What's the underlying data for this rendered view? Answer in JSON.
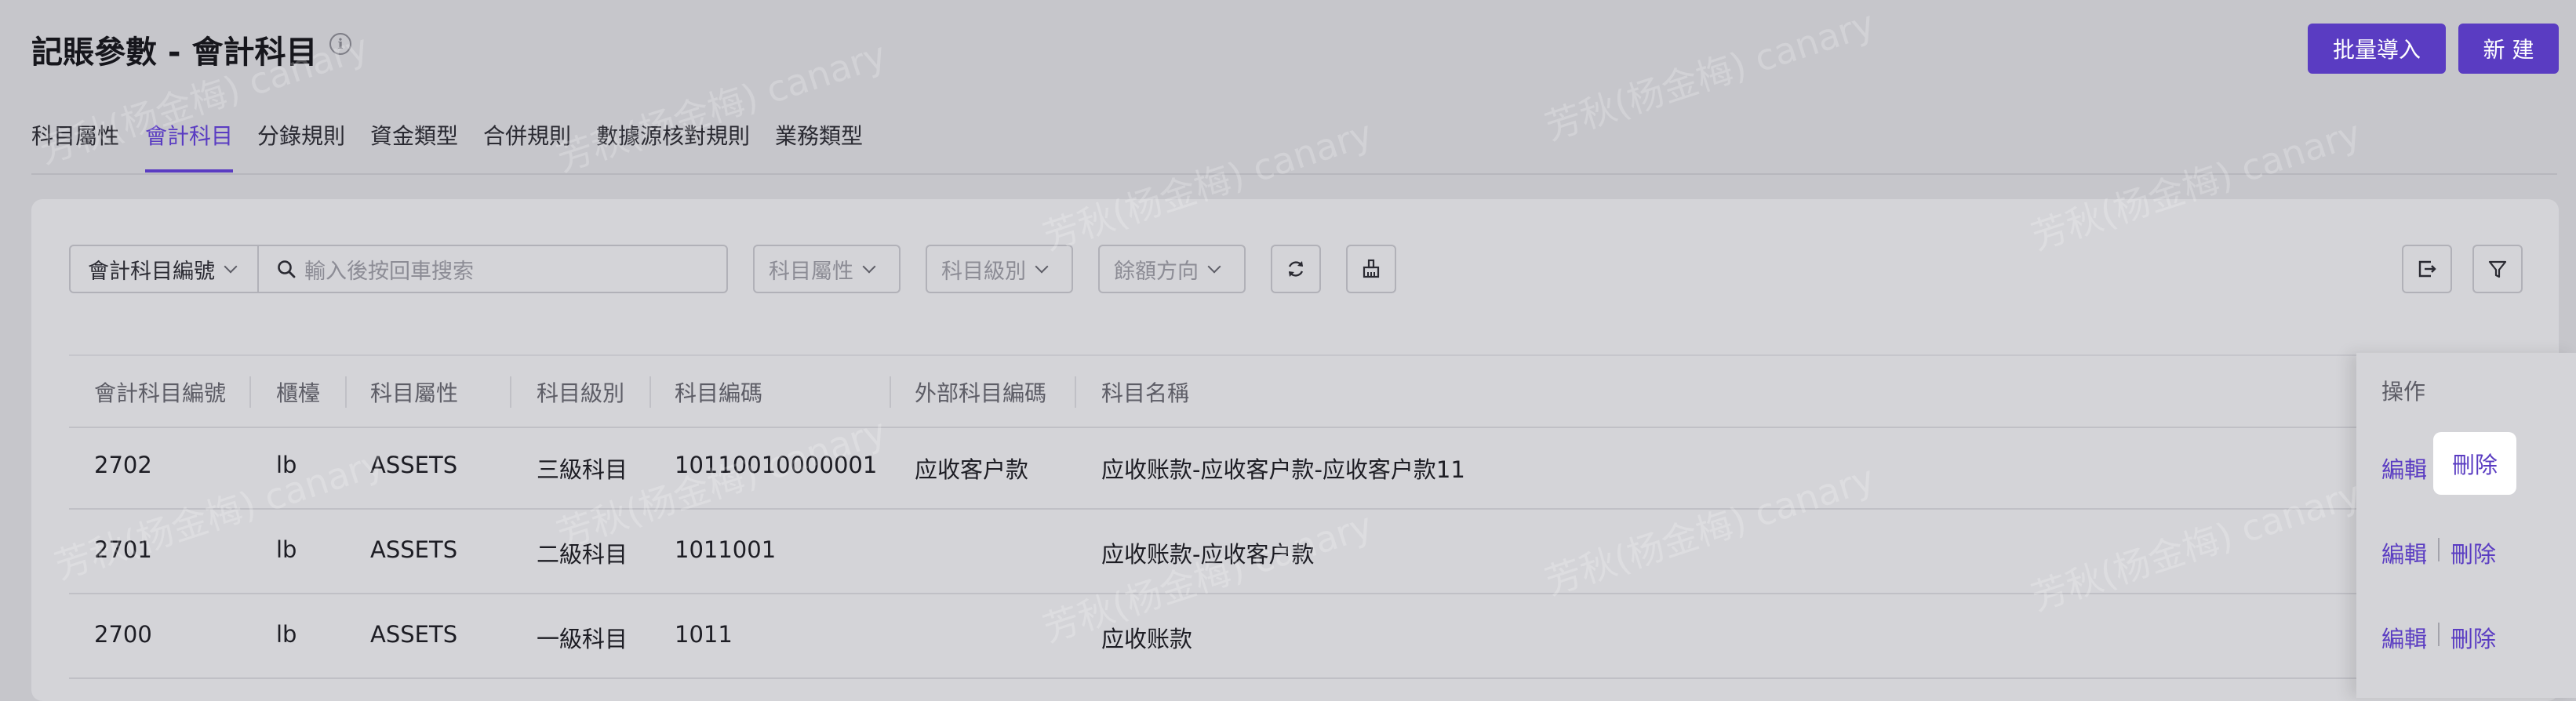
{
  "page": {
    "title": "記賬參數 - 會計科目",
    "info_icon": "info-circle-icon"
  },
  "header_buttons": {
    "batch_import": "批量導入",
    "create_new": "新 建"
  },
  "tabs": [
    {
      "label": "科目屬性",
      "active": false
    },
    {
      "label": "會計科目",
      "active": true
    },
    {
      "label": "分錄規則",
      "active": false
    },
    {
      "label": "資金類型",
      "active": false
    },
    {
      "label": "合併規則",
      "active": false
    },
    {
      "label": "數據源核對規則",
      "active": false
    },
    {
      "label": "業務類型",
      "active": false
    }
  ],
  "toolbar": {
    "search_field_select": "會計科目編號",
    "search_placeholder": "輸入後按回車搜索",
    "filter_attribute": "科目屬性",
    "filter_level": "科目級別",
    "filter_balance_direction": "餘額方向",
    "refresh_icon": "refresh-icon",
    "clean_icon": "broom-icon",
    "export_icon": "export-icon",
    "filter_icon": "filter-icon"
  },
  "table": {
    "columns": [
      "會計科目編號",
      "櫃檯",
      "科目屬性",
      "科目級別",
      "科目編碼",
      "外部科目編碼",
      "科目名稱",
      "操作"
    ],
    "rows": [
      {
        "id": "2702",
        "counter": "lb",
        "attribute": "ASSETS",
        "level": "三級科目",
        "code": "10110010000001",
        "external_code": "应收客户款",
        "name": "应收账款-应收客户款-应收客户款11"
      },
      {
        "id": "2701",
        "counter": "lb",
        "attribute": "ASSETS",
        "level": "二級科目",
        "code": "1011001",
        "external_code": "",
        "name": "应收账款-应收客户款"
      },
      {
        "id": "2700",
        "counter": "lb",
        "attribute": "ASSETS",
        "level": "一級科目",
        "code": "1011",
        "external_code": "",
        "name": "应收账款"
      }
    ],
    "actions": {
      "edit": "編輯",
      "delete": "刪除"
    }
  },
  "watermark": "芳秋(杨金梅) canary",
  "colors": {
    "accent": "#5a3cc2",
    "background": "#c6c6cb",
    "panel": "#d4d4d8"
  }
}
